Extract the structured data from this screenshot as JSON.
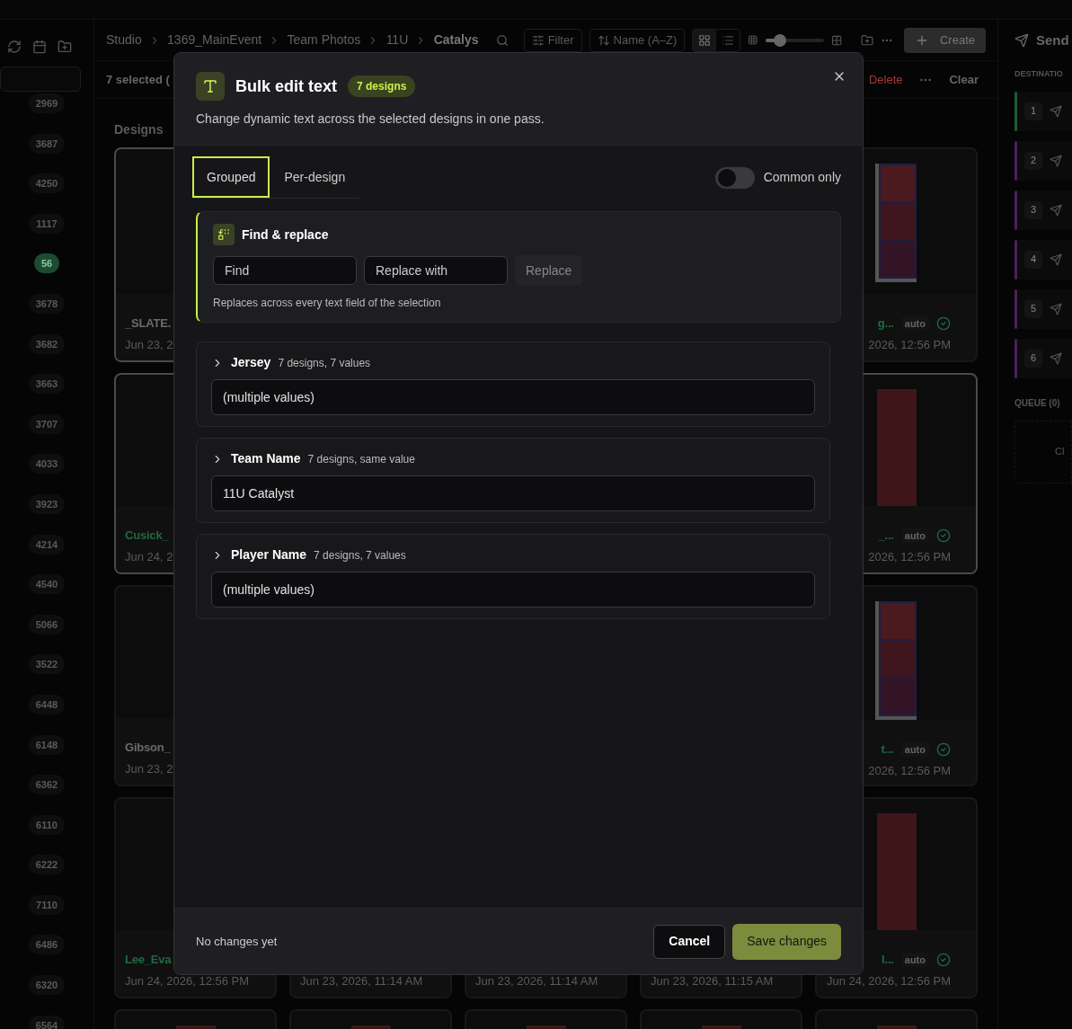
{
  "left_rail": {
    "counts": [
      {
        "label": "2969",
        "active": false
      },
      {
        "label": "3687",
        "active": false
      },
      {
        "label": "4250",
        "active": false
      },
      {
        "label": "1117",
        "active": false
      },
      {
        "label": "56",
        "active": true
      },
      {
        "label": "3678",
        "active": false
      },
      {
        "label": "3682",
        "active": false
      },
      {
        "label": "3663",
        "active": false
      },
      {
        "label": "3707",
        "active": false
      },
      {
        "label": "4033",
        "active": false
      },
      {
        "label": "3923",
        "active": false
      },
      {
        "label": "4214",
        "active": false
      },
      {
        "label": "4540",
        "active": false
      },
      {
        "label": "5066",
        "active": false
      },
      {
        "label": "3522",
        "active": false
      },
      {
        "label": "6448",
        "active": false
      },
      {
        "label": "6148",
        "active": false
      },
      {
        "label": "6362",
        "active": false
      },
      {
        "label": "6110",
        "active": false
      },
      {
        "label": "6222",
        "active": false
      },
      {
        "label": "7110",
        "active": false
      },
      {
        "label": "6486",
        "active": false
      },
      {
        "label": "6320",
        "active": false
      },
      {
        "label": "6564",
        "active": false
      }
    ]
  },
  "breadcrumb": [
    {
      "label": "Studio",
      "current": false
    },
    {
      "label": "1369_MainEvent",
      "current": false
    },
    {
      "label": "Team Photos",
      "current": false
    },
    {
      "label": "11U",
      "current": false
    },
    {
      "label": "Catalys",
      "current": true
    }
  ],
  "toolbar": {
    "filter": "Filter",
    "sort": "Name (A–Z)",
    "views": [
      {
        "kind": "grid",
        "selected": true
      },
      {
        "kind": "list",
        "selected": false
      }
    ],
    "zoom": {
      "level": 0.25
    },
    "create": "Create"
  },
  "selection_bar": {
    "summary": "7 selected (",
    "delete": "Delete",
    "clear": "Clear"
  },
  "section_title": "Designs",
  "design_rows": [
    [
      {
        "kind": "blank",
        "title": "_SLATE.",
        "color": "#6b6b6b",
        "date": "Jun 23, 2",
        "selected": true
      },
      {},
      {},
      {},
      {
        "kind": "sheet",
        "title": "g...",
        "color": "#1f6a40",
        "tag": "auto",
        "date": "2026, 12:56 PM",
        "selected": false
      }
    ],
    [
      {
        "kind": "blank",
        "title": "Cusick_",
        "color": "#1f6a40",
        "date": "Jun 24, 2",
        "selected": true
      },
      {},
      {},
      {},
      {
        "kind": "photo",
        "title": "_...",
        "color": "#1f6a40",
        "tag": "auto",
        "date": "2026, 12:56 PM",
        "selected": true
      }
    ],
    [
      {
        "kind": "blank",
        "title": "Gibson_",
        "color": "#6b6b6b",
        "date": "Jun 23, 2",
        "selected": false
      },
      {},
      {},
      {},
      {
        "kind": "sheet",
        "title": "t...",
        "color": "#1f6a40",
        "tag": "auto",
        "date": "2026, 12:56 PM",
        "selected": false
      }
    ],
    [
      {
        "kind": "blank",
        "title": "Lee_Eva",
        "color": "#1f6a40",
        "date": "Jun 24, 2026, 12:56 PM",
        "selected": false
      },
      {
        "kind": "blank",
        "date": "Jun 23, 2026, 11:14 AM",
        "selected": false
      },
      {
        "kind": "blank",
        "date": "Jun 23, 2026, 11:14 AM",
        "selected": false
      },
      {
        "kind": "blank",
        "date": "Jun 23, 2026, 11:15 AM",
        "selected": false
      },
      {
        "kind": "photo",
        "title": "l...",
        "color": "#1f6a40",
        "tag": "auto",
        "date": "Jun 24, 2026, 12:56 PM",
        "selected": false
      }
    ],
    [
      {
        "kind": "photo",
        "selected": false
      },
      {
        "kind": "photo",
        "selected": false
      },
      {
        "kind": "photo",
        "selected": false
      },
      {
        "kind": "photo",
        "selected": false
      },
      {
        "kind": "photo",
        "selected": false
      }
    ]
  ],
  "send_panel": {
    "title": "Send",
    "destinations_heading": "DESTINATIO",
    "destinations": [
      {
        "number": "1",
        "color": "#1d5c3a"
      },
      {
        "number": "2",
        "color": "#4c1f5e"
      },
      {
        "number": "3",
        "color": "#4c1f5e"
      },
      {
        "number": "4",
        "color": "#4c1f5e"
      },
      {
        "number": "5",
        "color": "#4c1f5e"
      },
      {
        "number": "6",
        "color": "#4c1f5e"
      }
    ],
    "queue_heading": "QUEUE (0)",
    "queue_hint": "Cl"
  },
  "dialog": {
    "title": "Bulk edit text",
    "badge": "7 designs",
    "subtitle": "Change dynamic text across the selected designs in one pass.",
    "tabs": [
      {
        "label": "Grouped",
        "selected": true
      },
      {
        "label": "Per-design",
        "selected": false
      }
    ],
    "common_only": {
      "label": "Common only",
      "on": false
    },
    "find_replace": {
      "title": "Find & replace",
      "find": {
        "placeholder": "Find"
      },
      "replace": {
        "placeholder": "Replace with"
      },
      "button": {
        "label": "Replace",
        "disabled": true
      },
      "hint": "Replaces across every text field of the selection"
    },
    "fields": [
      {
        "label": "Jersey",
        "meta": "7 designs, 7 values",
        "expanded": false,
        "placeholder": "(multiple values)"
      },
      {
        "label": "Team Name",
        "meta": "7 designs, same value",
        "expanded": false,
        "value": "11U Catalyst"
      },
      {
        "label": "Player Name",
        "meta": "7 designs, 7 values",
        "expanded": false,
        "placeholder": "(multiple values)"
      }
    ],
    "status": "No changes yet",
    "cancel": "Cancel",
    "save": "Save changes"
  }
}
